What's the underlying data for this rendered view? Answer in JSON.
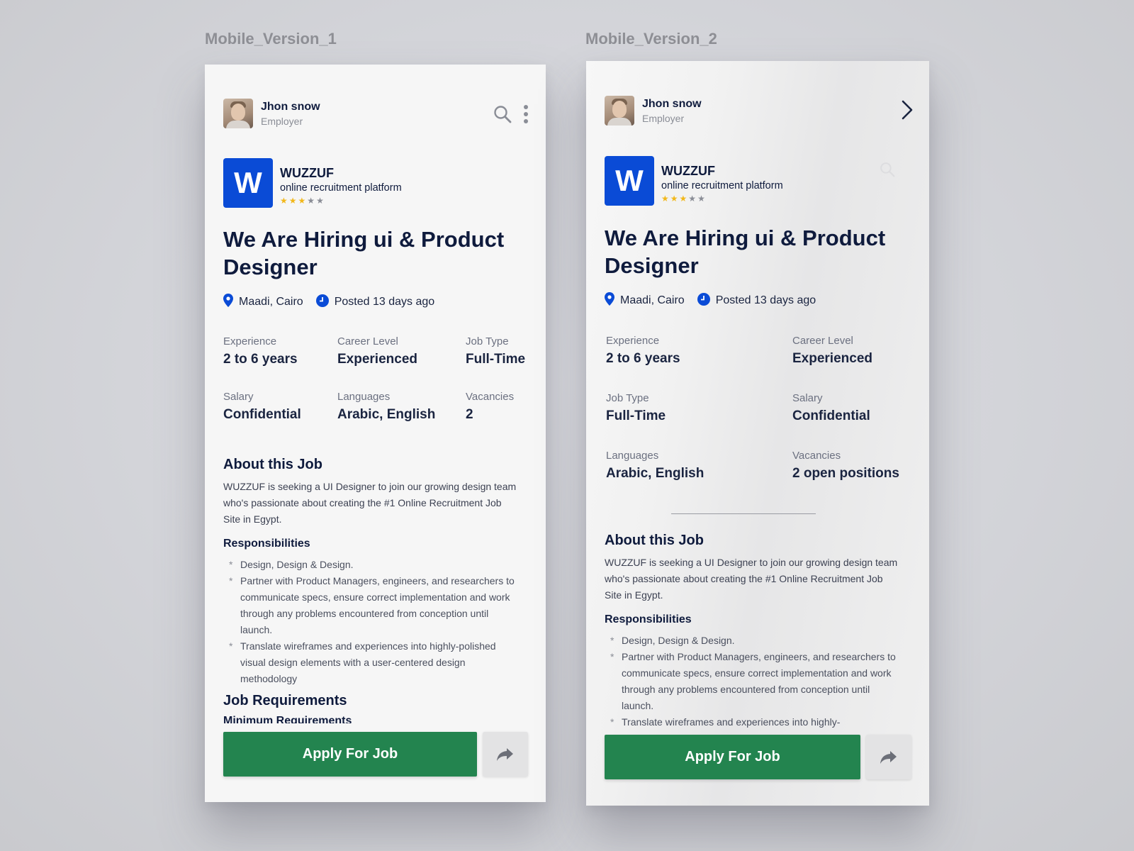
{
  "frames": [
    {
      "title": "Mobile_Version_1",
      "user": {
        "name": "Jhon snow",
        "role": "Employer"
      },
      "company": {
        "logo_letter": "W",
        "name": "WUZZUF",
        "description": "online recruitment platform",
        "rating": 3,
        "rating_max": 5
      },
      "job_title": "We Are Hiring ui & Product Designer",
      "location": "Maadi, Cairo",
      "posted": "Posted 13 days ago",
      "details": [
        {
          "label": "Experience",
          "value": "2 to 6 years"
        },
        {
          "label": "Career Level",
          "value": "Experienced"
        },
        {
          "label": "Job Type",
          "value": "Full-Time"
        },
        {
          "label": "Salary",
          "value": "Confidential"
        },
        {
          "label": "Languages",
          "value": "Arabic, English"
        },
        {
          "label": "Vacancies",
          "value": "2"
        }
      ],
      "about": {
        "heading": "About this Job",
        "text": "WUZZUF is seeking a UI Designer to join our growing design team who's passionate about creating the #1 Online Recruitment Job Site in Egypt.",
        "responsibilities_heading": "Responsibilities",
        "responsibilities": [
          "Design, Design & Design.",
          "Partner with Product Managers, engineers, and researchers to communicate specs, ensure correct implementation and work through any problems encountered from conception until launch.",
          "Translate wireframes and experiences into highly-polished visual design elements with a user-centered design methodology"
        ],
        "requirements_heading": "Job Requirements",
        "min_requirements": "Minimum Requirements"
      },
      "apply_label": "Apply For Job"
    },
    {
      "title": "Mobile_Version_2",
      "user": {
        "name": "Jhon snow",
        "role": "Employer"
      },
      "company": {
        "logo_letter": "W",
        "name": "WUZZUF",
        "description": "online recruitment platform",
        "rating": 3,
        "rating_max": 5
      },
      "job_title": "We Are Hiring ui & Product Designer",
      "location": "Maadi, Cairo",
      "posted": "Posted 13 days ago",
      "details": [
        {
          "label": "Experience",
          "value": "2 to 6 years"
        },
        {
          "label": "Career Level",
          "value": "Experienced"
        },
        {
          "label": "Job Type",
          "value": "Full-Time"
        },
        {
          "label": "Salary",
          "value": "Confidential"
        },
        {
          "label": "Languages",
          "value": "Arabic, English"
        },
        {
          "label": "Vacancies",
          "value": "2 open positions"
        }
      ],
      "about": {
        "heading": "About this Job",
        "text": "WUZZUF is seeking a UI Designer to join our growing design team who's passionate about creating the #1 Online Recruitment Job Site in Egypt.",
        "responsibilities_heading": "Responsibilities",
        "responsibilities": [
          "Design, Design & Design.",
          "Partner with Product Managers, engineers, and researchers to communicate specs, ensure correct implementation and work through any problems encountered from conception until launch.",
          "Translate wireframes and experiences into highly-"
        ]
      },
      "apply_label": "Apply For Job"
    }
  ],
  "colors": {
    "brand_blue": "#0a4bd6",
    "apply_green": "#23844f",
    "star_on": "#f2b81b",
    "star_off": "#8a8d96",
    "heading": "#0f1b3d"
  },
  "icons": [
    "search-icon",
    "more-vertical-icon",
    "chevron-right-icon",
    "location-pin-icon",
    "clock-icon",
    "share-icon",
    "star-icon"
  ]
}
